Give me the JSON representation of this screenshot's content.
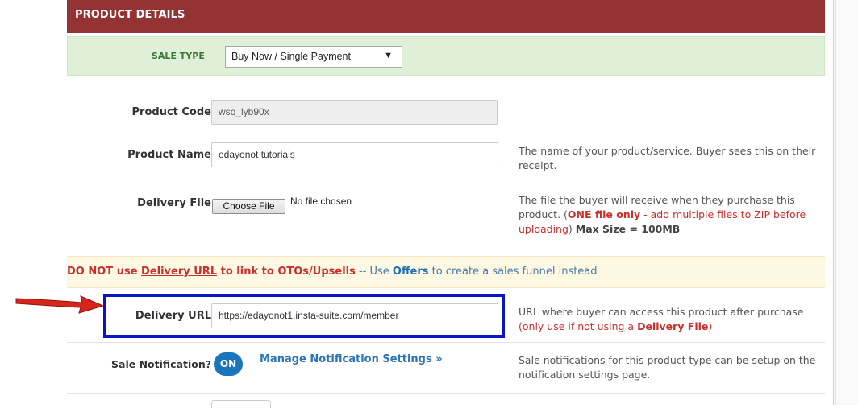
{
  "header": {
    "title": "PRODUCT DETAILS",
    "bg_color": "#943333"
  },
  "sale_type": {
    "label": "SALE TYPE",
    "selected": "Buy Now / Single Payment",
    "chevron": "▼"
  },
  "product_code": {
    "label": "Product Code",
    "value": "wso_lyb90x"
  },
  "product_name": {
    "label": "Product Name",
    "value": "edayonot tutorials",
    "help": "The name of your product/service. Buyer sees this on their receipt."
  },
  "delivery_file": {
    "label": "Delivery File",
    "button": "Choose File",
    "status": "No file chosen",
    "help_part1": "The file the buyer will receive when they purchase this product. (",
    "help_red_bold": "ONE file only",
    "help_red": " - add multiple files to ZIP before uploading",
    "help_part2": ") ",
    "help_bold": "Max Size = 100MB"
  },
  "warning": {
    "part1": "DO NOT use ",
    "part2_link": "Delivery URL",
    "part3": " to link to OTOs/Upsells",
    "part4": " -- Use ",
    "part5_link": "Offers",
    "part6": " to create a sales funnel instead"
  },
  "delivery_url": {
    "label": "Delivery URL",
    "value": "https://edayonot1.insta-suite.com/member",
    "help_part1": "URL where buyer can access this product after purchase ",
    "help_red": "(only use if not using a ",
    "help_red_bold": "Delivery File",
    "help_red_end": ")"
  },
  "sale_notification": {
    "label": "Sale Notification?",
    "toggle": "ON",
    "link": "Manage Notification Settings »",
    "help": "Sale notifications for this product type can be setup on the notification settings page."
  },
  "colors": {
    "highlight_box": "#0a14c8",
    "arrow": "#d9241a",
    "toggle": "#1b75bb",
    "sale_type_bg": "#dff0d8",
    "warning_bg": "#fcf8e3"
  }
}
